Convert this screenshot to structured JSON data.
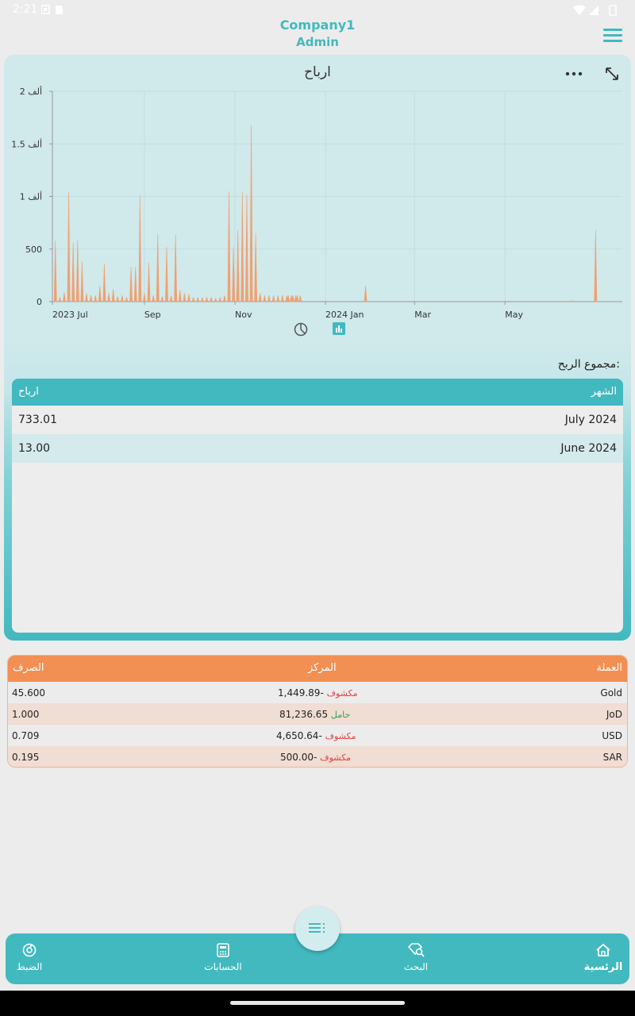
{
  "status_bar": {
    "time": "2:21"
  },
  "header": {
    "company": "Company1",
    "role": "Admin"
  },
  "chart_data": {
    "type": "bar",
    "title": "ارباح",
    "xlabel": "",
    "ylabel": "",
    "x_ticks": [
      "2023 Jul",
      "Sep",
      "Nov",
      "2024 Jan",
      "Mar",
      "May"
    ],
    "y_ticks": [
      "0",
      "500",
      "1 ألف",
      "1.5 ألف",
      "2 ألف"
    ],
    "ylim": [
      0,
      2000
    ],
    "grid": true,
    "color": "#f0a070",
    "x": [
      "2023-07-03",
      "2023-07-06",
      "2023-07-09",
      "2023-07-12",
      "2023-07-15",
      "2023-07-18",
      "2023-07-21",
      "2023-07-24",
      "2023-07-27",
      "2023-07-30",
      "2023-08-02",
      "2023-08-05",
      "2023-08-08",
      "2023-08-11",
      "2023-08-14",
      "2023-08-17",
      "2023-08-20",
      "2023-08-23",
      "2023-08-26",
      "2023-08-29",
      "2023-09-01",
      "2023-09-04",
      "2023-09-07",
      "2023-09-10",
      "2023-09-13",
      "2023-09-16",
      "2023-09-19",
      "2023-09-22",
      "2023-09-25",
      "2023-09-28",
      "2023-10-01",
      "2023-10-04",
      "2023-10-07",
      "2023-10-10",
      "2023-10-13",
      "2023-10-16",
      "2023-10-19",
      "2023-10-22",
      "2023-10-25",
      "2023-10-28",
      "2023-10-31",
      "2023-11-03",
      "2023-11-06",
      "2023-11-09",
      "2023-11-12",
      "2023-11-15",
      "2023-11-18",
      "2023-11-21",
      "2023-11-24",
      "2023-11-27",
      "2023-11-30",
      "2023-12-03",
      "2023-12-06",
      "2023-12-07",
      "2023-12-09",
      "2023-12-10",
      "2023-12-12",
      "2023-12-13",
      "2023-12-15",
      "2024-01-28",
      "2024-06-15",
      "2024-07-01"
    ],
    "values": [
      580,
      40,
      90,
      1040,
      560,
      590,
      380,
      80,
      60,
      60,
      150,
      360,
      80,
      120,
      50,
      60,
      40,
      330,
      330,
      1010,
      80,
      370,
      60,
      640,
      50,
      520,
      60,
      640,
      110,
      80,
      70,
      40,
      40,
      40,
      40,
      40,
      30,
      40,
      60,
      1050,
      520,
      680,
      1040,
      1020,
      1680,
      650,
      80,
      60,
      60,
      60,
      60,
      60,
      60,
      60,
      60,
      60,
      60,
      60,
      60,
      150,
      10,
      680
    ]
  },
  "chart_toggles": {
    "pie": "pie-chart-icon",
    "bar": "bar-chart-icon"
  },
  "profit_summary": {
    "label": "مجموع الربح:",
    "headers": {
      "month": "الشهر",
      "profit": "ارباح"
    },
    "rows": [
      {
        "month": "July 2024",
        "profit": "733.01"
      },
      {
        "month": "June 2024",
        "profit": "13.00"
      }
    ]
  },
  "currency_table": {
    "headers": {
      "currency": "العملة",
      "position": "المركز",
      "rate": "الصرف"
    },
    "rows": [
      {
        "currency": "Gold",
        "position": "-1,449.89",
        "status": "مكشوف",
        "rate": "45.600"
      },
      {
        "currency": "JoD",
        "position": "81,236.65",
        "status": "حامل",
        "rate": "1.000"
      },
      {
        "currency": "USD",
        "position": "-4,650.64",
        "status": "مكشوف",
        "rate": "0.709"
      },
      {
        "currency": "SAR",
        "position": "-500.00",
        "status": "مكشوف",
        "rate": "0.195"
      }
    ]
  },
  "bottom_nav": {
    "home": "الرئسية",
    "search": "البحث",
    "accounts": "الحسابات",
    "settings": "الضبط"
  },
  "colors": {
    "accent": "#42b9bf",
    "orange": "#f28f52",
    "bar": "#f0a070"
  }
}
